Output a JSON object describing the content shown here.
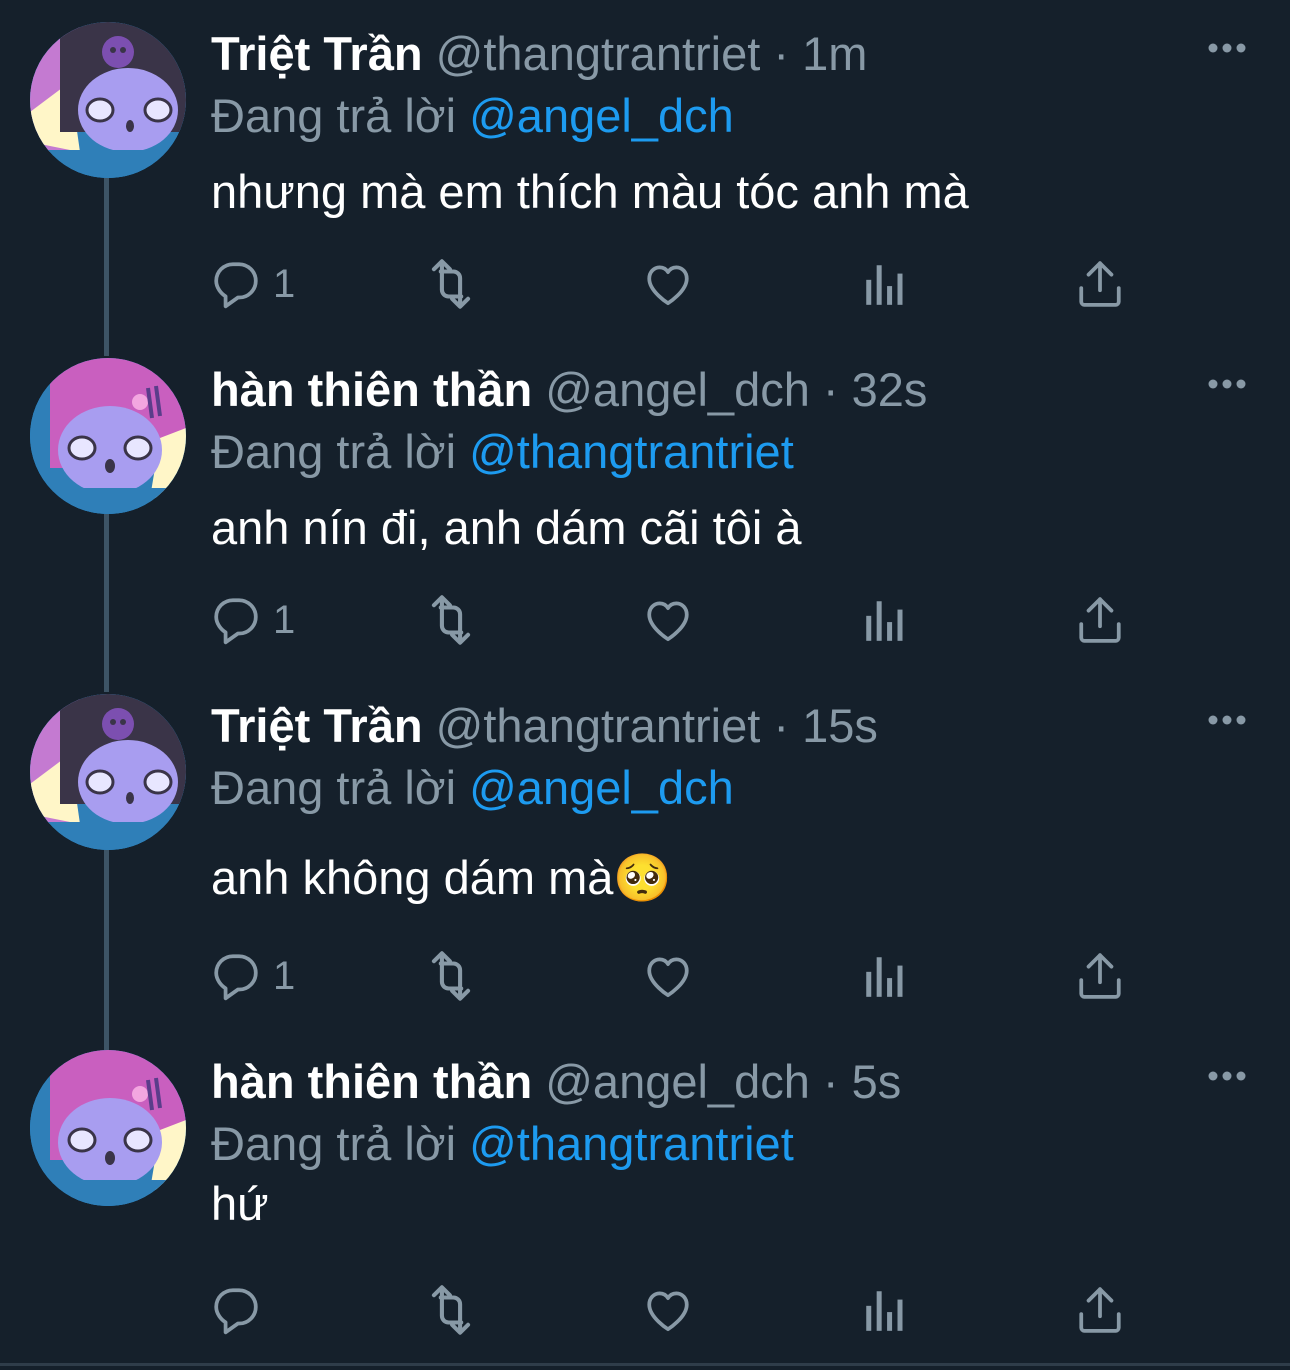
{
  "colors": {
    "background": "#15202b",
    "text_primary": "#ffffff",
    "text_secondary": "#8899a6",
    "accent": "#1d9bf0",
    "thread_line": "#3d5466"
  },
  "reply_prefix": "Đang trả lời",
  "tweets": [
    {
      "display_name": "Triệt Trần",
      "handle": "@thangtrantriet",
      "dot": "·",
      "time": "1m",
      "reply_to": "@angel_dch",
      "text": "nhưng mà em thích màu tóc anh mà",
      "reply_count": "1",
      "avatar_icon": "kuromi-avatar-icon"
    },
    {
      "display_name": "hàn thiên thần",
      "handle": "@angel_dch",
      "dot": "·",
      "time": "32s",
      "reply_to": "@thangtrantriet",
      "text": "anh nín đi, anh dám cãi tôi à",
      "reply_count": "1",
      "avatar_icon": "my-melody-avatar-icon"
    },
    {
      "display_name": "Triệt Trần",
      "handle": "@thangtrantriet",
      "dot": "·",
      "time": "15s",
      "reply_to": "@angel_dch",
      "text": "anh không dám mà🥺",
      "reply_count": "1",
      "avatar_icon": "kuromi-avatar-icon"
    },
    {
      "display_name": "hàn thiên thần",
      "handle": "@angel_dch",
      "dot": "·",
      "time": "5s",
      "reply_to": "@thangtrantriet",
      "text": "hứ",
      "reply_count": "",
      "avatar_icon": "my-melody-avatar-icon"
    }
  ],
  "icons": {
    "reply": "reply-icon",
    "retweet": "retweet-icon",
    "like": "heart-icon",
    "views": "analytics-icon",
    "share": "share-icon",
    "more": "more-icon"
  }
}
